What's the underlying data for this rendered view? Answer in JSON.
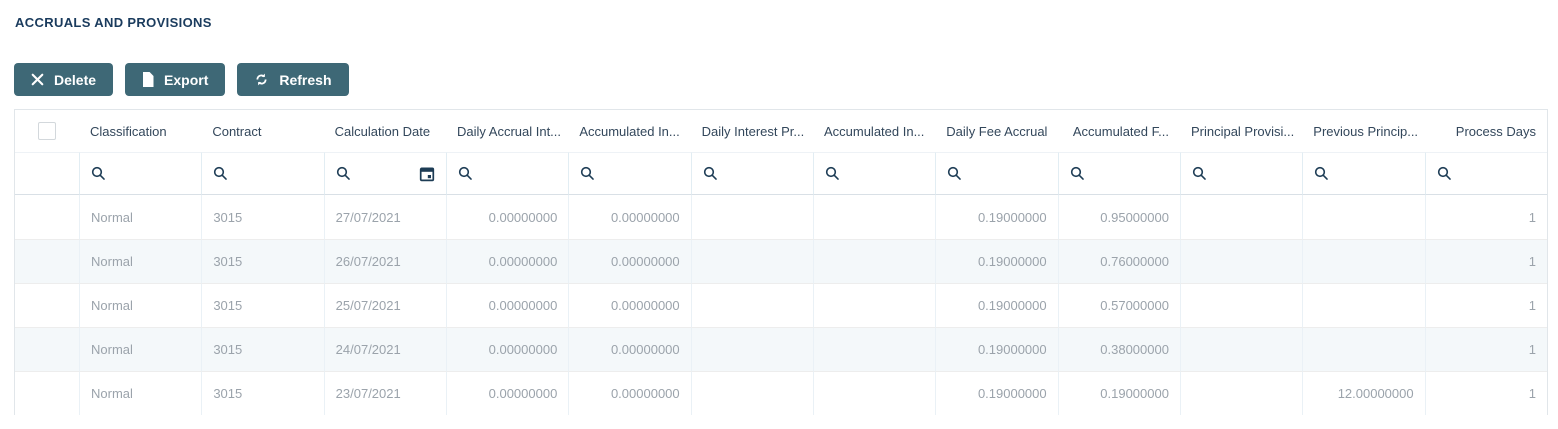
{
  "page": {
    "title": "ACCRUALS AND PROVISIONS"
  },
  "toolbar": {
    "buttons": [
      {
        "id": "delete",
        "label": "Delete",
        "icon": "x-icon"
      },
      {
        "id": "export",
        "label": "Export",
        "icon": "document-icon"
      },
      {
        "id": "refresh",
        "label": "Refresh",
        "icon": "refresh-icon"
      }
    ]
  },
  "table": {
    "columns": [
      {
        "key": "select",
        "label": "",
        "type": "checkbox",
        "align": "center"
      },
      {
        "key": "classification",
        "label": "Classification",
        "align": "left"
      },
      {
        "key": "contract",
        "label": "Contract",
        "align": "left"
      },
      {
        "key": "calculation_date",
        "label": "Calculation Date",
        "align": "left",
        "filter_calendar": true
      },
      {
        "key": "daily_accrual_interest",
        "label": "Daily Accrual Int...",
        "align": "right"
      },
      {
        "key": "accumulated_interest",
        "label": "Accumulated In...",
        "align": "right"
      },
      {
        "key": "daily_interest_provision",
        "label": "Daily Interest Pr...",
        "align": "right"
      },
      {
        "key": "accumulated_interest_provision",
        "label": "Accumulated In...",
        "align": "right"
      },
      {
        "key": "daily_fee_accrual",
        "label": "Daily Fee Accrual",
        "align": "right"
      },
      {
        "key": "accumulated_fee",
        "label": "Accumulated F...",
        "align": "right"
      },
      {
        "key": "principal_provision",
        "label": "Principal Provisi...",
        "align": "right"
      },
      {
        "key": "previous_principal",
        "label": "Previous Princip...",
        "align": "right"
      },
      {
        "key": "process_days",
        "label": "Process Days",
        "align": "right"
      }
    ],
    "rows": [
      {
        "classification": "Normal",
        "contract": "3015",
        "calculation_date": "27/07/2021",
        "daily_accrual_interest": "0.00000000",
        "accumulated_interest": "0.00000000",
        "daily_interest_provision": "",
        "accumulated_interest_provision": "",
        "daily_fee_accrual": "0.19000000",
        "accumulated_fee": "0.95000000",
        "principal_provision": "",
        "previous_principal": "",
        "process_days": "1"
      },
      {
        "classification": "Normal",
        "contract": "3015",
        "calculation_date": "26/07/2021",
        "daily_accrual_interest": "0.00000000",
        "accumulated_interest": "0.00000000",
        "daily_interest_provision": "",
        "accumulated_interest_provision": "",
        "daily_fee_accrual": "0.19000000",
        "accumulated_fee": "0.76000000",
        "principal_provision": "",
        "previous_principal": "",
        "process_days": "1"
      },
      {
        "classification": "Normal",
        "contract": "3015",
        "calculation_date": "25/07/2021",
        "daily_accrual_interest": "0.00000000",
        "accumulated_interest": "0.00000000",
        "daily_interest_provision": "",
        "accumulated_interest_provision": "",
        "daily_fee_accrual": "0.19000000",
        "accumulated_fee": "0.57000000",
        "principal_provision": "",
        "previous_principal": "",
        "process_days": "1"
      },
      {
        "classification": "Normal",
        "contract": "3015",
        "calculation_date": "24/07/2021",
        "daily_accrual_interest": "0.00000000",
        "accumulated_interest": "0.00000000",
        "daily_interest_provision": "",
        "accumulated_interest_provision": "",
        "daily_fee_accrual": "0.19000000",
        "accumulated_fee": "0.38000000",
        "principal_provision": "",
        "previous_principal": "",
        "process_days": "1"
      },
      {
        "classification": "Normal",
        "contract": "3015",
        "calculation_date": "23/07/2021",
        "daily_accrual_interest": "0.00000000",
        "accumulated_interest": "0.00000000",
        "daily_interest_provision": "",
        "accumulated_interest_provision": "",
        "daily_fee_accrual": "0.19000000",
        "accumulated_fee": "0.19000000",
        "principal_provision": "",
        "previous_principal": "12.00000000",
        "process_days": "1"
      }
    ]
  },
  "icons": {
    "filter_search": "search-icon",
    "date_filter": "calendar-icon"
  },
  "colors": {
    "button_bg": "#3e6876",
    "button_text": "#ffffff",
    "title_text": "#1a3b5d",
    "header_text": "#33475b",
    "cell_text": "#9ba3ab",
    "row_stripe": "#f4f8fa",
    "grid_line_vertical": "#e2edf3",
    "grid_line_horizontal": "#ededed",
    "icon_dark": "#1d3c55"
  }
}
